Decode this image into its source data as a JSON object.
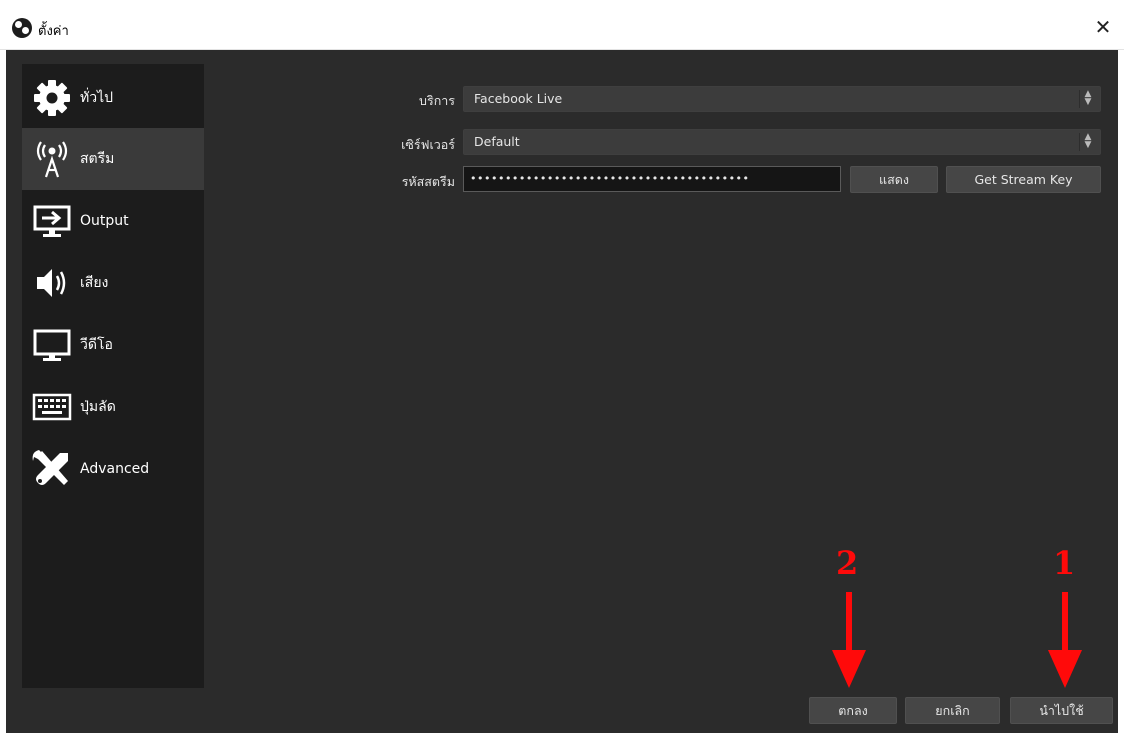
{
  "window": {
    "title": "ตั้งค่า",
    "close_glyph": "✕"
  },
  "sidebar": {
    "items": [
      {
        "label": "ทั่วไป",
        "icon": "gear-icon"
      },
      {
        "label": "สตรีม",
        "icon": "broadcast-tower-icon",
        "selected": true
      },
      {
        "label": "Output",
        "icon": "output-monitor-icon"
      },
      {
        "label": "เสียง",
        "icon": "speaker-icon"
      },
      {
        "label": "วีดีโอ",
        "icon": "monitor-icon"
      },
      {
        "label": "ปุ่มลัด",
        "icon": "keyboard-icon"
      },
      {
        "label": "Advanced",
        "icon": "tools-icon"
      }
    ]
  },
  "stream": {
    "service_label": "บริการ",
    "service_value": "Facebook Live",
    "server_label": "เซิร์ฟเวอร์",
    "server_value": "Default",
    "key_label": "รหัสสตรีม",
    "key_value": "••••••••••••••••••••••••••••••••••••••••",
    "show_button": "แสดง",
    "get_key_button": "Get Stream Key"
  },
  "footer": {
    "ok_button": "ตกลง",
    "cancel_button": "ยกเลิก",
    "apply_button": "นำไปใช้"
  },
  "annotations": [
    {
      "label": "2",
      "color": "#ff0a0a"
    },
    {
      "label": "1",
      "color": "#ff0a0a"
    }
  ]
}
